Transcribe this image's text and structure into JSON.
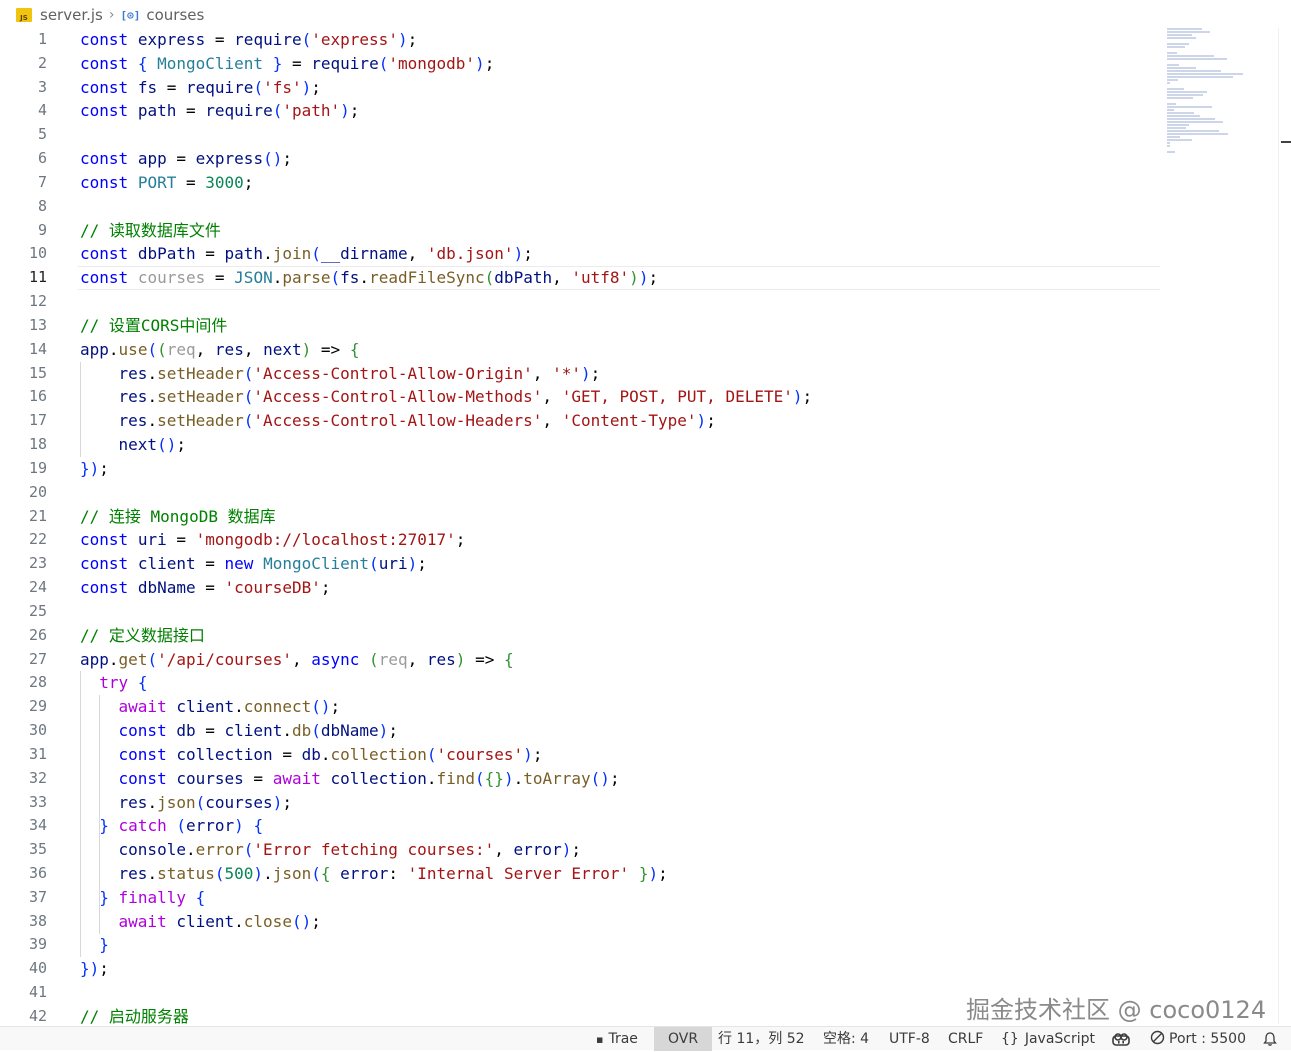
{
  "breadcrumb": {
    "file_icon": "js-file-icon",
    "file": "server.js",
    "separator": "chevron-right-icon",
    "symbol_icon": "variable-symbol-icon",
    "symbol": "courses"
  },
  "editor": {
    "current_line": 11,
    "lines": [
      {
        "n": "1",
        "t": "const express = require('express');"
      },
      {
        "n": "2",
        "t": "const { MongoClient } = require('mongodb');"
      },
      {
        "n": "3",
        "t": "const fs = require('fs');"
      },
      {
        "n": "4",
        "t": "const path = require('path');"
      },
      {
        "n": "5",
        "t": ""
      },
      {
        "n": "6",
        "t": "const app = express();"
      },
      {
        "n": "7",
        "t": "const PORT = 3000;"
      },
      {
        "n": "8",
        "t": ""
      },
      {
        "n": "9",
        "t": "// 读取数据库文件"
      },
      {
        "n": "10",
        "t": "const dbPath = path.join(__dirname, 'db.json');"
      },
      {
        "n": "11",
        "t": "const courses = JSON.parse(fs.readFileSync(dbPath, 'utf8'));"
      },
      {
        "n": "12",
        "t": ""
      },
      {
        "n": "13",
        "t": "// 设置CORS中间件"
      },
      {
        "n": "14",
        "t": "app.use((req, res, next) => {"
      },
      {
        "n": "15",
        "t": "    res.setHeader('Access-Control-Allow-Origin', '*');"
      },
      {
        "n": "16",
        "t": "    res.setHeader('Access-Control-Allow-Methods', 'GET, POST, PUT, DELETE');"
      },
      {
        "n": "17",
        "t": "    res.setHeader('Access-Control-Allow-Headers', 'Content-Type');"
      },
      {
        "n": "18",
        "t": "    next();"
      },
      {
        "n": "19",
        "t": "});"
      },
      {
        "n": "20",
        "t": ""
      },
      {
        "n": "21",
        "t": "// 连接 MongoDB 数据库"
      },
      {
        "n": "22",
        "t": "const uri = 'mongodb://localhost:27017';"
      },
      {
        "n": "23",
        "t": "const client = new MongoClient(uri);"
      },
      {
        "n": "24",
        "t": "const dbName = 'courseDB';"
      },
      {
        "n": "25",
        "t": ""
      },
      {
        "n": "26",
        "t": "// 定义数据接口"
      },
      {
        "n": "27",
        "t": "app.get('/api/courses', async (req, res) => {"
      },
      {
        "n": "28",
        "t": "  try {"
      },
      {
        "n": "29",
        "t": "    await client.connect();"
      },
      {
        "n": "30",
        "t": "    const db = client.db(dbName);"
      },
      {
        "n": "31",
        "t": "    const collection = db.collection('courses');"
      },
      {
        "n": "32",
        "t": "    const courses = await collection.find({}).toArray();"
      },
      {
        "n": "33",
        "t": "    res.json(courses);"
      },
      {
        "n": "34",
        "t": "  } catch (error) {"
      },
      {
        "n": "35",
        "t": "    console.error('Error fetching courses:', error);"
      },
      {
        "n": "36",
        "t": "    res.status(500).json({ error: 'Internal Server Error' });"
      },
      {
        "n": "37",
        "t": "  } finally {"
      },
      {
        "n": "38",
        "t": "    await client.close();"
      },
      {
        "n": "39",
        "t": "  }"
      },
      {
        "n": "40",
        "t": "});"
      },
      {
        "n": "41",
        "t": ""
      },
      {
        "n": "42",
        "t": "// 启动服务器"
      }
    ]
  },
  "statusbar": {
    "trae": "Trae",
    "trae_icon": "terminal-icon",
    "ovr": "OVR",
    "position": "行 11，列 52",
    "indent": "空格: 4",
    "encoding": "UTF-8",
    "eol": "CRLF",
    "language": "JavaScript",
    "language_icon": "braces-icon",
    "copilot_icon": "copilot-icon",
    "port": "Port : 5500",
    "port_icon": "circle-slash-icon",
    "bell_icon": "bell-icon"
  },
  "watermark": "掘金技术社区 @ coco0124",
  "colors": {
    "keyword": "#0000ff",
    "comment": "#008000",
    "string": "#a31515",
    "number": "#098658",
    "variable": "#001080",
    "type": "#267f99",
    "function": "#795e26",
    "control": "#af00db"
  }
}
